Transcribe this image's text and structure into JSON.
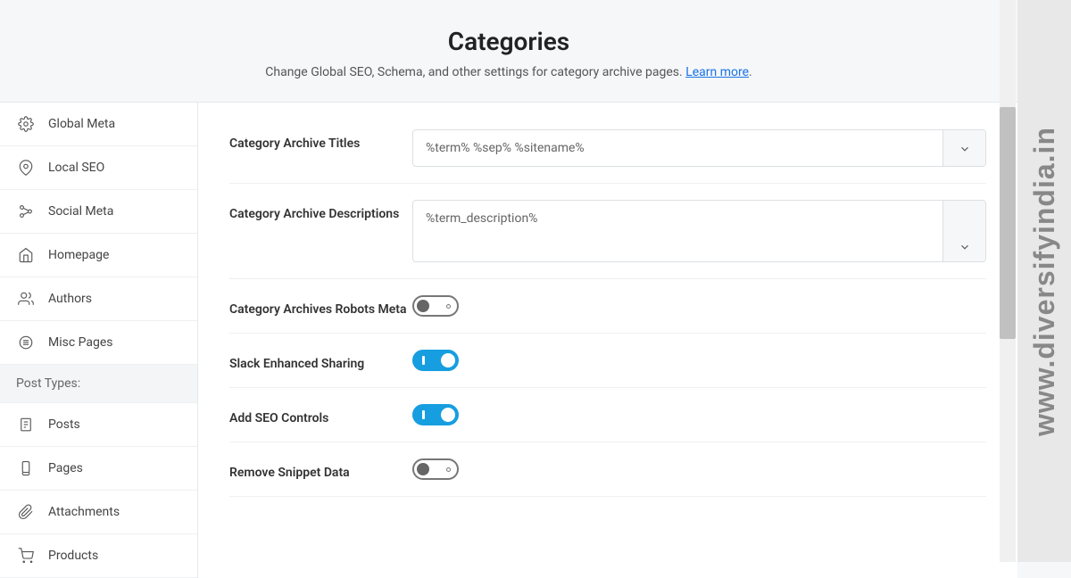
{
  "header": {
    "title": "Categories",
    "subtitle_pre": "Change Global SEO, Schema, and other settings for category archive pages. ",
    "learn_more": "Learn more",
    "subtitle_post": "."
  },
  "sidebar": {
    "items": [
      {
        "label": "Global Meta"
      },
      {
        "label": "Local SEO"
      },
      {
        "label": "Social Meta"
      },
      {
        "label": "Homepage"
      },
      {
        "label": "Authors"
      },
      {
        "label": "Misc Pages"
      }
    ],
    "group_label": "Post Types:",
    "post_types": [
      {
        "label": "Posts"
      },
      {
        "label": "Pages"
      },
      {
        "label": "Attachments"
      },
      {
        "label": "Products"
      }
    ]
  },
  "form": {
    "archive_titles": {
      "label": "Category Archive Titles",
      "value": "%term% %sep% %sitename%"
    },
    "archive_descriptions": {
      "label": "Category Archive Descriptions",
      "value": "%term_description%"
    },
    "robots_meta": {
      "label": "Category Archives Robots Meta"
    },
    "slack_sharing": {
      "label": "Slack Enhanced Sharing"
    },
    "seo_controls": {
      "label": "Add SEO Controls"
    },
    "snippet_data": {
      "label": "Remove Snippet Data"
    }
  },
  "watermark": "www.diversifyindia.in"
}
